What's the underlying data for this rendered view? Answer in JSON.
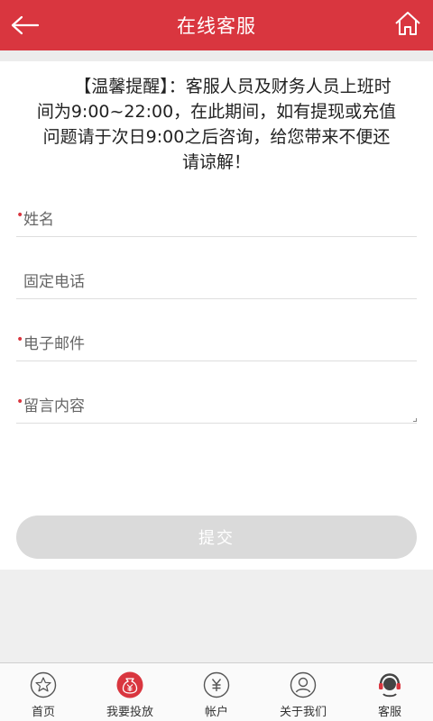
{
  "header": {
    "title": "在线客服",
    "back_icon": "back-arrow-icon",
    "home_icon": "home-icon"
  },
  "notice": {
    "text": "【温馨提醒】：客服人员及财务人员上班时间为9:00~22:00，在此期间，如有提现或充值问题请于次日9:00之后咨询，给您带来不便还请谅解！"
  },
  "form": {
    "name_placeholder": "姓名",
    "phone_placeholder": "固定电话",
    "email_placeholder": "电子邮件",
    "message_placeholder": "留言内容",
    "required_mark": "•",
    "submit_label": "提交"
  },
  "tabbar": {
    "items": [
      {
        "label": "首页",
        "icon": "star-icon"
      },
      {
        "label": "我要投放",
        "icon": "money-bag-icon"
      },
      {
        "label": "帐户",
        "icon": "yen-coin-icon"
      },
      {
        "label": "关于我们",
        "icon": "person-icon"
      },
      {
        "label": "客服",
        "icon": "headset-icon"
      }
    ]
  },
  "colors": {
    "brand": "#d9363f",
    "submit_disabled": "#dadada",
    "background_gray": "#efefef"
  }
}
